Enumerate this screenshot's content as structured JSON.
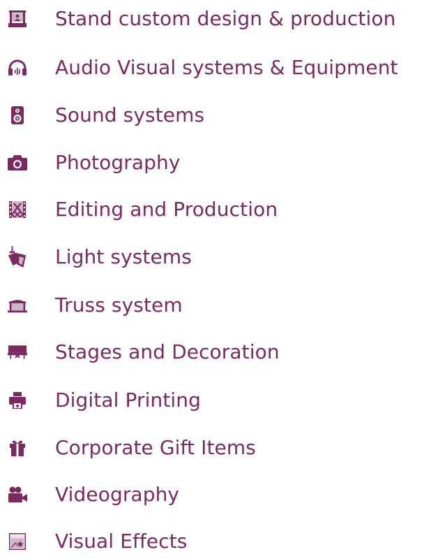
{
  "colors": {
    "accent": "#7b2a5f",
    "icon_light": "#cfb5c8"
  },
  "services": [
    {
      "label": "Stand custom design & production",
      "icon": "booth-icon"
    },
    {
      "label": "Audio Visual systems & Equipment",
      "icon": "headphones-icon"
    },
    {
      "label": "Sound systems",
      "icon": "speaker-icon"
    },
    {
      "label": "Photography",
      "icon": "camera-icon"
    },
    {
      "label": "Editing and Production",
      "icon": "film-scissors-icon"
    },
    {
      "label": "Light systems",
      "icon": "spotlight-icon"
    },
    {
      "label": "Truss system",
      "icon": "truss-stage-icon"
    },
    {
      "label": "Stages and Decoration",
      "icon": "stage-platform-icon"
    },
    {
      "label": "Digital Printing",
      "icon": "printer-icon"
    },
    {
      "label": "Corporate Gift Items",
      "icon": "gift-icon"
    },
    {
      "label": "Videography",
      "icon": "video-camera-icon"
    },
    {
      "label": "Visual Effects",
      "icon": "visual-effects-icon"
    }
  ]
}
